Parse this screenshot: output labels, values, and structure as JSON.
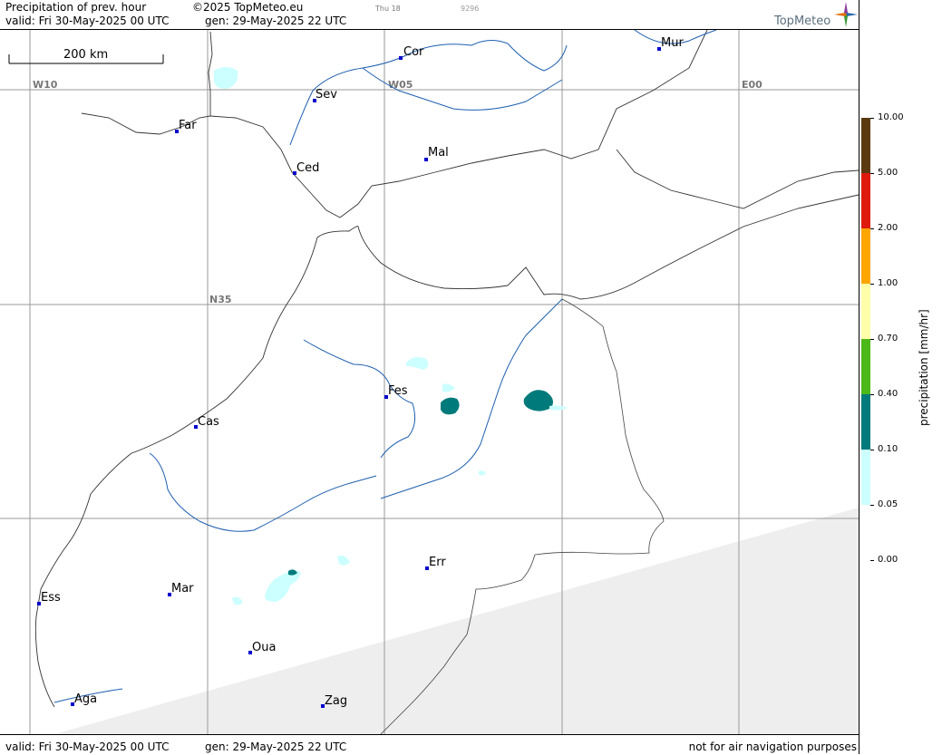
{
  "header": {
    "title": "Precipitation of prev. hour",
    "copyright": "©2025 TopMeteo.eu",
    "valid": "valid:  Fri  30-May-2025  00 UTC",
    "gen": "gen: 29-May-2025 22 UTC",
    "tiny_day": "Thu 18",
    "tiny_code": "9296",
    "brand": "TopMeteo"
  },
  "scale": {
    "label": "200 km"
  },
  "grid_labels": {
    "w10": "W10",
    "w05": "W05",
    "e00": "E00",
    "n35": "N35"
  },
  "cities": [
    {
      "key": "cor",
      "label": "Cor"
    },
    {
      "key": "mur",
      "label": "Mur"
    },
    {
      "key": "sev",
      "label": "Sev"
    },
    {
      "key": "far",
      "label": "Far"
    },
    {
      "key": "ced",
      "label": "Ced"
    },
    {
      "key": "mal",
      "label": "Mal"
    },
    {
      "key": "fes",
      "label": "Fes"
    },
    {
      "key": "cas",
      "label": "Cas"
    },
    {
      "key": "err",
      "label": "Err"
    },
    {
      "key": "mar",
      "label": "Mar"
    },
    {
      "key": "ess",
      "label": "Ess"
    },
    {
      "key": "oua",
      "label": "Oua"
    },
    {
      "key": "aga",
      "label": "Aga"
    },
    {
      "key": "zag",
      "label": "Zag"
    }
  ],
  "legend": {
    "title": "precipitation  [mm/hr]",
    "levels": [
      {
        "label": "10.00",
        "color": "#5a3a10"
      },
      {
        "label": "5.00",
        "color": "#dd1a0c"
      },
      {
        "label": "2.00",
        "color": "#ffa500"
      },
      {
        "label": "1.00",
        "color": "#ffffaa"
      },
      {
        "label": "0.70",
        "color": "#4cb81a"
      },
      {
        "label": "0.40",
        "color": "#007a7a"
      },
      {
        "label": "0.10",
        "color": "#ccffff"
      },
      {
        "label": "0.05",
        "color": "#ffffff"
      },
      {
        "label": "0.00",
        "color": "#ffffff"
      }
    ]
  },
  "footer": {
    "valid": "valid:  Fri  30-May-2025  00 UTC",
    "gen": "gen: 29-May-2025 22 UTC",
    "disclaimer": "not for air navigation purposes"
  }
}
